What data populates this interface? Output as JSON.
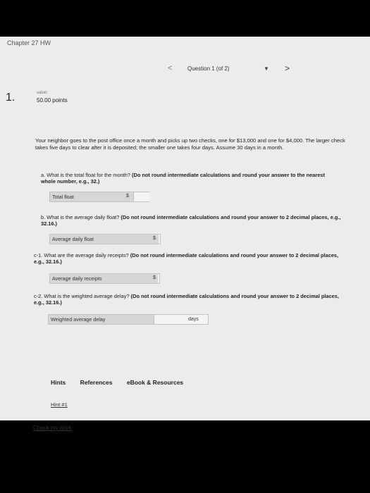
{
  "header": {
    "chapter_title": "Chapter 27 HW"
  },
  "question_nav": {
    "prev_glyph": "<",
    "label": "Question 1 (of 2)",
    "dropdown_glyph": "▼",
    "next_glyph": ">"
  },
  "question": {
    "number": "1.",
    "value_label": "value:",
    "points": "50.00 points",
    "intro": "Your neighbor goes to the post office once a month and picks up two checks, one for $13,000 and one for $4,000. The larger check takes five days to clear after it is deposited; the smaller one takes four days. Assume 30 days in a month.",
    "parts": [
      {
        "id": "a",
        "prefix": "a.",
        "question": "What is the total float for the month?",
        "instruction": "(Do not round intermediate calculations and round your answer to the nearest whole number, e.g., 32.)",
        "answer_label": "Total float",
        "prefix_unit": "$",
        "suffix_unit": "",
        "value": ""
      },
      {
        "id": "b",
        "prefix": "b.",
        "question": "What is the average daily float?",
        "instruction": "(Do not round intermediate calculations and round your answer to 2 decimal places, e.g., 32.16.)",
        "answer_label": "Average daily float",
        "prefix_unit": "$",
        "suffix_unit": "",
        "value": ""
      },
      {
        "id": "c1",
        "prefix": "c-1.",
        "question": "What are the average daily receipts?",
        "instruction": "(Do not round intermediate calculations and round your answer to 2 decimal places, e.g., 32.16.)",
        "answer_label": "Average daily receipts",
        "prefix_unit": "$",
        "suffix_unit": "",
        "value": ""
      },
      {
        "id": "c2",
        "prefix": "c-2.",
        "question": "What is the weighted average delay?",
        "instruction": "(Do not round intermediate calculations and round your answer to 2 decimal places, e.g., 32.16.)",
        "answer_label": "Weighted average delay",
        "prefix_unit": "",
        "suffix_unit": "days",
        "value": ""
      }
    ]
  },
  "tabs": {
    "hints": "Hints",
    "references": "References",
    "ebook": "eBook & Resources"
  },
  "hint_link": "Hint #1",
  "check_link": "Check my work"
}
